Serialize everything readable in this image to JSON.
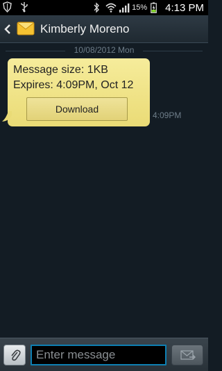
{
  "status_bar": {
    "battery_percent": "15%",
    "time": "4:13 PM",
    "icons": [
      "shield-icon",
      "usb-icon",
      "bluetooth-icon",
      "wifi-icon",
      "signal-icon",
      "battery-icon"
    ]
  },
  "header": {
    "contact_name": "Kimberly Moreno",
    "icons": [
      "back-icon",
      "envelope-icon"
    ]
  },
  "thread": {
    "date_separator": "10/08/2012 Mon",
    "message": {
      "size_text": "Message size: 1KB",
      "expires_text": "Expires: 4:09PM, Oct 12",
      "download_label": "Download",
      "time": "4:09PM"
    }
  },
  "composer": {
    "input_placeholder": "Enter message",
    "input_value": "",
    "icons": [
      "paperclip-icon",
      "send-icon"
    ]
  },
  "colors": {
    "bubble": "#f2e68e",
    "background": "#131c24",
    "input_border": "#0e7fb2"
  }
}
